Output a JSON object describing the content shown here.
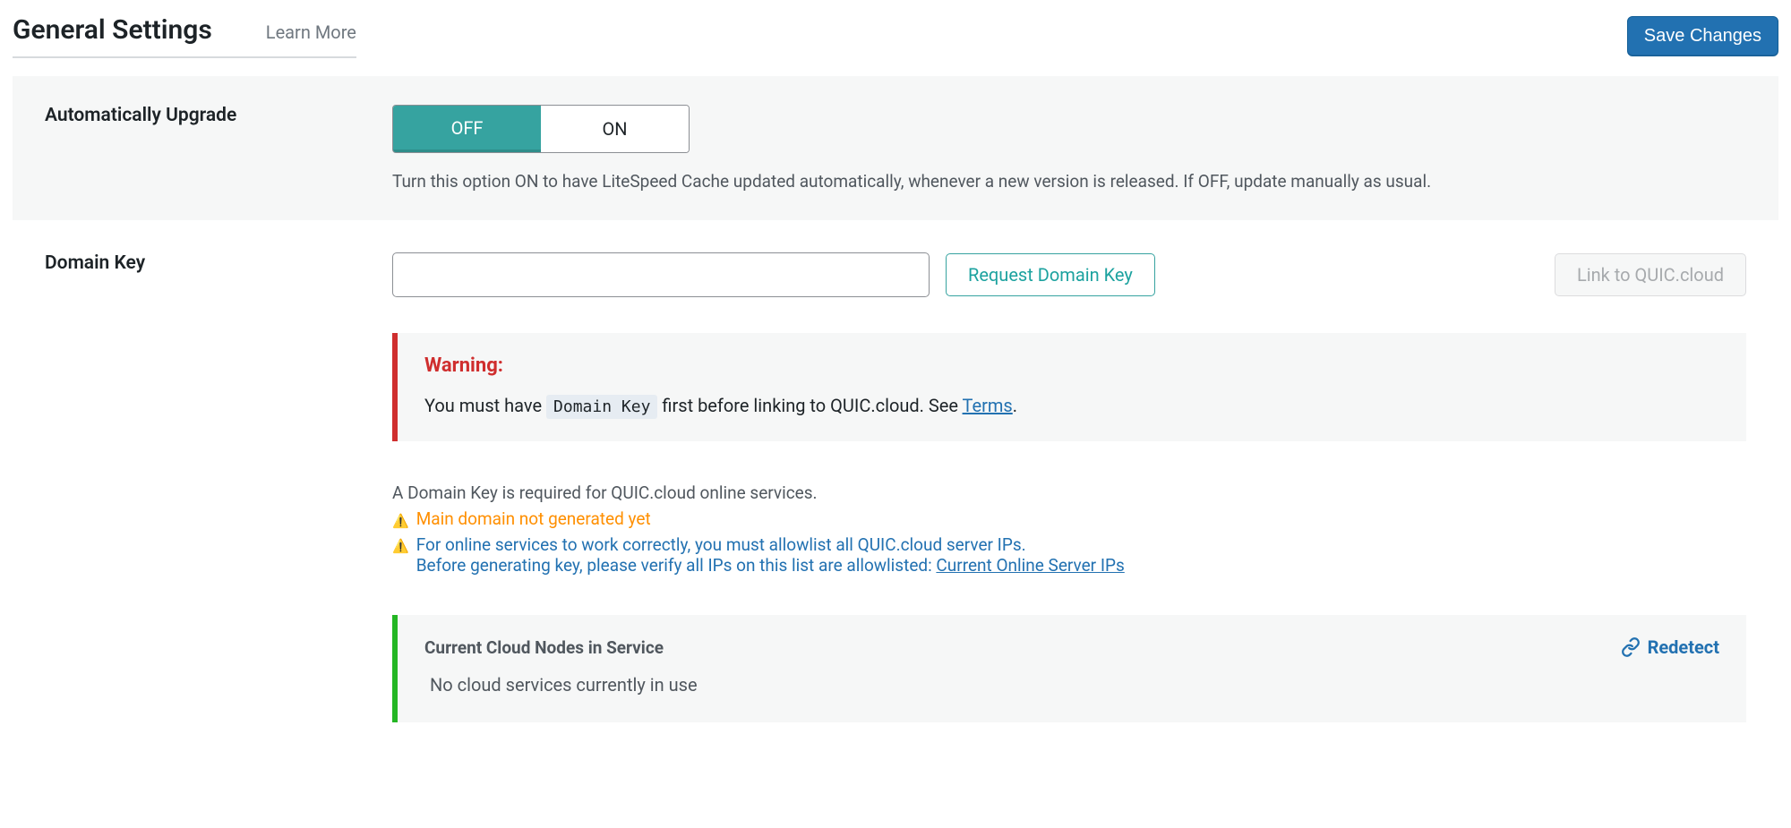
{
  "header": {
    "title": "General Settings",
    "learn_more": "Learn More",
    "save": "Save Changes"
  },
  "auto_upgrade": {
    "label": "Automatically Upgrade",
    "off": "OFF",
    "on": "ON",
    "description": "Turn this option ON to have LiteSpeed Cache updated automatically, whenever a new version is released. If OFF, update manually as usual."
  },
  "domain_key": {
    "label": "Domain Key",
    "value": "",
    "request_btn": "Request Domain Key",
    "link_btn": "Link to QUIC.cloud",
    "warning_title": "Warning:",
    "warning_pre": "You must have ",
    "warning_code": "Domain Key",
    "warning_mid": " first before linking to QUIC.cloud. See ",
    "warning_link": "Terms",
    "warning_post": ".",
    "info_required": "A Domain Key is required for QUIC.cloud online services.",
    "info_main_domain": "Main domain not generated yet",
    "info_allowlist": "For online services to work correctly, you must allowlist all QUIC.cloud server IPs.",
    "info_before": "Before generating key, please verify all IPs on this list are allowlisted: ",
    "info_ips_link": "Current Online Server IPs"
  },
  "nodes": {
    "title": "Current Cloud Nodes in Service",
    "redetect": "Redetect",
    "empty": "No cloud services currently in use"
  }
}
